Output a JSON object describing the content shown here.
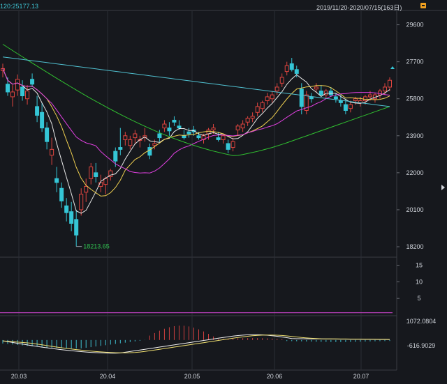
{
  "header": {
    "ma_readout": "120:25177.13",
    "date_range": "2019/11/20-2020/07/15(163日)"
  },
  "chart_data": [
    {
      "type": "candlestick",
      "panel": "price",
      "y_ticks": [
        29600,
        27700,
        25800,
        23900,
        22000,
        20100,
        18200
      ],
      "ylim": [
        17700,
        30300
      ],
      "x_ticks": [
        "20.03",
        "20.04",
        "20.05",
        "20.06",
        "20.07"
      ],
      "low_annotation": {
        "text": "18213.65",
        "value": 18213.65
      },
      "colors": {
        "up": "#e0453f",
        "down": "#35c6d6",
        "ma5": "#e8e8e8",
        "ma10": "#f0d050",
        "ma20": "#e040e0",
        "ma60": "#30c030",
        "ma120": "#50c0d0"
      }
    },
    {
      "type": "line",
      "panel": "volume",
      "y_ticks": [
        15,
        10,
        5
      ],
      "ylim": [
        0,
        17
      ],
      "colors": {
        "line": "#c040c0"
      }
    },
    {
      "type": "macd",
      "panel": "macd",
      "y_ticks": [
        "1072.0804",
        "-616.9029"
      ],
      "ylim": [
        -616.9029,
        1072.0804
      ],
      "colors": {
        "pos": "#d04040",
        "neg": "#40c0d0",
        "dif": "#f0f0f0",
        "dea": "#f0e070"
      }
    }
  ]
}
